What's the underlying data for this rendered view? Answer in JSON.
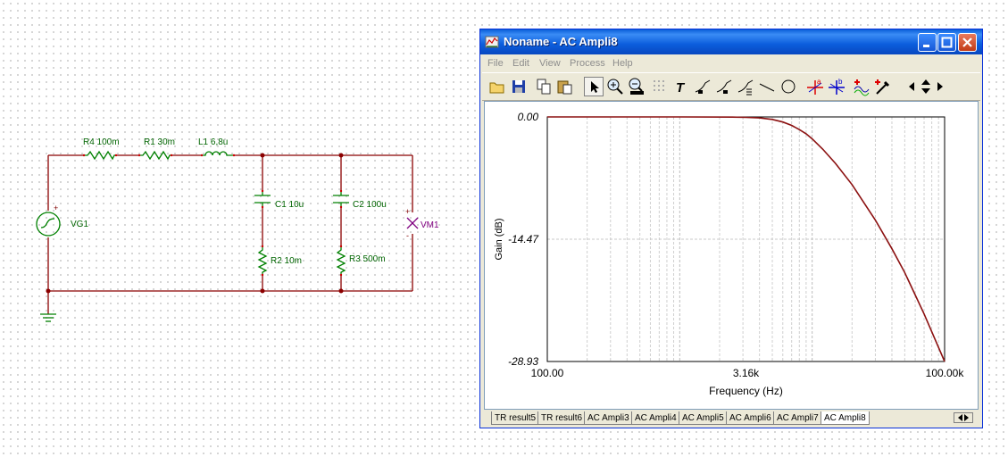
{
  "schematic": {
    "components": {
      "r4": "R4 100m",
      "r1": "R1 30m",
      "l1": "L1 6,8u",
      "c1": "C1 10u",
      "c2": "C2 100u",
      "r2": "R2 10m",
      "r3": "R3 500m",
      "vg1": "VG1",
      "vm1": "VM1"
    },
    "colors": {
      "wire": "#8b0000",
      "component": "#008000",
      "meter": "#800080"
    }
  },
  "window": {
    "title": "Noname - AC Ampli8",
    "menu": [
      "File",
      "Edit",
      "View",
      "Process",
      "Help"
    ],
    "toolbar_icons": [
      "open-folder-icon",
      "save-icon",
      "copy-icon",
      "paste-icon",
      "pointer-icon",
      "zoom-in-icon",
      "zoom-out-icon",
      "grid-icon",
      "text-icon",
      "label-icon",
      "label2-icon",
      "legend-icon",
      "line-icon",
      "circle-icon",
      "cursor-a-icon",
      "cursor-b-icon",
      "add-trace-icon",
      "pick-trace-icon",
      "pan-left-icon",
      "pan-updown-icon",
      "pan-right-icon"
    ],
    "tabs": [
      "TR result5",
      "TR result6",
      "AC Ampli3",
      "AC Ampli4",
      "AC Ampli5",
      "AC Ampli6",
      "AC Ampli7",
      "AC Ampli8"
    ],
    "active_tab": "AC Ampli8"
  },
  "chart_data": {
    "type": "line",
    "title": "",
    "xlabel": "Frequency (Hz)",
    "ylabel": "Gain (dB)",
    "xscale": "log",
    "xlim": [
      100,
      100000
    ],
    "ylim": [
      -28.93,
      0
    ],
    "xticks": [
      {
        "value": 100,
        "label": "100.00"
      },
      {
        "value": 3162,
        "label": "3.16k"
      },
      {
        "value": 100000,
        "label": "100.00k"
      }
    ],
    "yticks": [
      {
        "value": 0,
        "label": "0.00"
      },
      {
        "value": -14.47,
        "label": "-14.47"
      },
      {
        "value": -28.93,
        "label": "-28.93"
      }
    ],
    "grid": true,
    "series": [
      {
        "color": "#8b1010",
        "x": [
          100,
          1000,
          2500,
          3162,
          4000,
          5000,
          6000,
          7000,
          8000,
          9000,
          10000,
          12000,
          15000,
          20000,
          30000,
          40000,
          50000,
          70000,
          100000
        ],
        "y": [
          0,
          0,
          -0.02,
          -0.05,
          -0.12,
          -0.3,
          -0.6,
          -1.0,
          -1.5,
          -2.0,
          -2.6,
          -3.8,
          -5.5,
          -8.0,
          -12.2,
          -15.6,
          -18.4,
          -23.3,
          -28.93
        ]
      }
    ]
  }
}
